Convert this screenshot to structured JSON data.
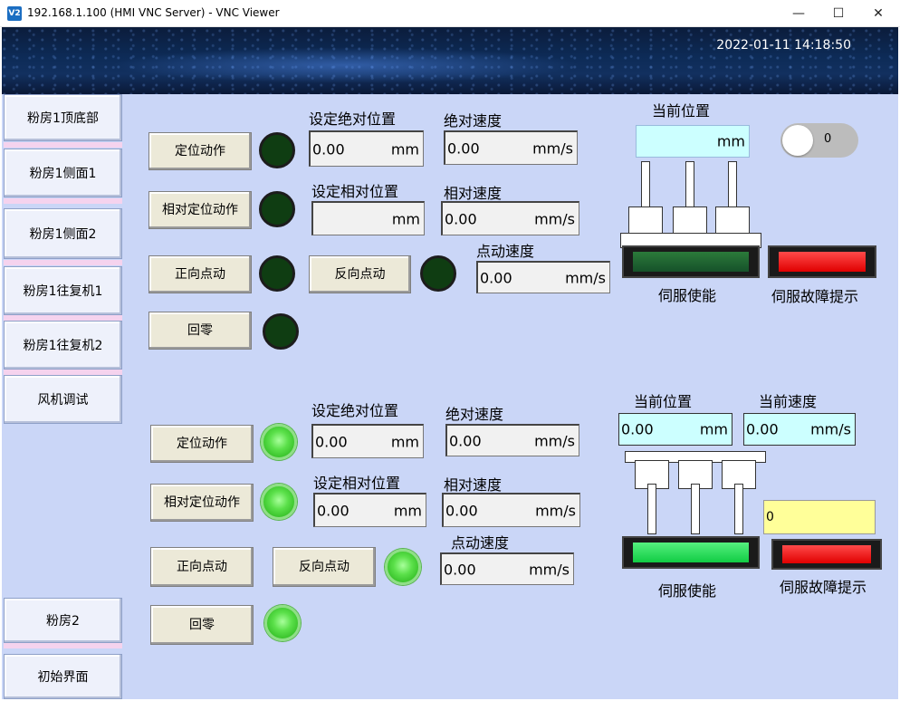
{
  "window": {
    "icon_text": "V2",
    "title": "192.168.1.100 (HMI VNC Server) - VNC Viewer",
    "minimize": "—",
    "maximize": "☐",
    "close": "✕"
  },
  "banner": {
    "datetime": "2022-01-11 14:18:50"
  },
  "sidebar": {
    "items": [
      {
        "label": "粉房1顶底部"
      },
      {
        "label": "粉房1侧面1"
      },
      {
        "label": "粉房1侧面2"
      },
      {
        "label": "粉房1往复机1"
      },
      {
        "label": "粉房1往复机2"
      },
      {
        "label": "风机调试"
      },
      {
        "label": "粉房2"
      },
      {
        "label": "初始界面"
      }
    ]
  },
  "top": {
    "btn_locate": "定位动作",
    "btn_rel_locate": "相对定位动作",
    "btn_fwd_jog": "正向点动",
    "btn_rev_jog": "反向点动",
    "btn_home": "回零",
    "lbl_abs_pos": "设定绝对位置",
    "lbl_abs_speed": "绝对速度",
    "lbl_rel_pos": "设定相对位置",
    "lbl_rel_speed": "相对速度",
    "lbl_jog_speed": "点动速度",
    "abs_pos_value": "0.00",
    "abs_pos_unit": "mm",
    "abs_speed_value": "0.00",
    "abs_speed_unit": "mm/s",
    "rel_pos_value": "",
    "rel_pos_unit": "mm",
    "rel_speed_value": "0.00",
    "rel_speed_unit": "mm/s",
    "jog_speed_value": "0.00",
    "jog_speed_unit": "mm/s",
    "lbl_cur_pos": "当前位置",
    "cur_pos_value": "",
    "cur_pos_unit": "mm",
    "toggle_value": "0",
    "lbl_servo_enable": "伺服使能",
    "lbl_servo_fault": "伺服故障提示"
  },
  "bottom": {
    "btn_locate": "定位动作",
    "btn_rel_locate": "相对定位动作",
    "btn_fwd_jog": "正向点动",
    "btn_rev_jog": "反向点动",
    "btn_home": "回零",
    "lbl_abs_pos": "设定绝对位置",
    "lbl_abs_speed": "绝对速度",
    "lbl_rel_pos": "设定相对位置",
    "lbl_rel_speed": "相对速度",
    "lbl_jog_speed": "点动速度",
    "abs_pos_value": "0.00",
    "abs_pos_unit": "mm",
    "abs_speed_value": "0.00",
    "abs_speed_unit": "mm/s",
    "rel_pos_value": "0.00",
    "rel_pos_unit": "mm",
    "rel_speed_value": "0.00",
    "rel_speed_unit": "mm/s",
    "jog_speed_value": "0.00",
    "jog_speed_unit": "mm/s",
    "lbl_cur_pos": "当前位置",
    "cur_pos_value": "0.00",
    "cur_pos_unit": "mm",
    "lbl_cur_speed": "当前速度",
    "cur_speed_value": "0.00",
    "cur_speed_unit": "mm/s",
    "yellow_value": "0",
    "lbl_servo_enable": "伺服使能",
    "lbl_servo_fault": "伺服故障提示"
  },
  "colors": {
    "panel_bg": "#cad6f7",
    "lamp_off": "#0f3d12",
    "lamp_on": "#5be04a",
    "fault_red": "#e00000",
    "servo_green_dark": "#16512a",
    "servo_green_bright": "#11cc44",
    "cyan_field": "#ccffff",
    "yellow_field": "#ffff99"
  }
}
